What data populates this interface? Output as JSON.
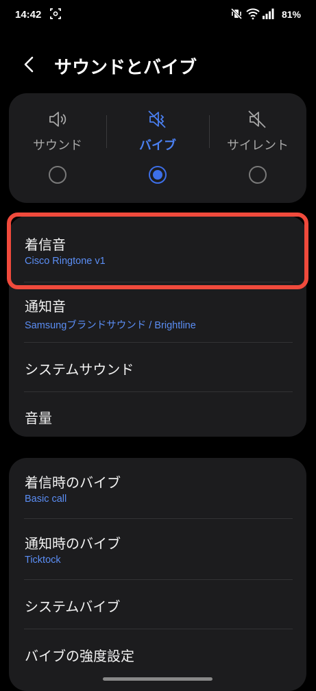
{
  "status_bar": {
    "time": "14:42",
    "battery": "81%"
  },
  "header": {
    "title": "サウンドとバイブ",
    "back_icon": "chevron-left-icon"
  },
  "modes": [
    {
      "label": "サウンド",
      "icon": "speaker-icon",
      "selected": false
    },
    {
      "label": "バイブ",
      "icon": "vibrate-icon",
      "selected": true
    },
    {
      "label": "サイレント",
      "icon": "mute-icon",
      "selected": false
    }
  ],
  "sound_settings": [
    {
      "title": "着信音",
      "subtitle": "Cisco Ringtone v1"
    },
    {
      "title": "通知音",
      "subtitle": "Samsungブランドサウンド / Brightline"
    },
    {
      "title": "システムサウンド"
    },
    {
      "title": "音量"
    }
  ],
  "vibration_settings": [
    {
      "title": "着信時のバイブ",
      "subtitle": "Basic call"
    },
    {
      "title": "通知時のバイブ",
      "subtitle": "Ticktock"
    },
    {
      "title": "システムバイブ"
    },
    {
      "title": "バイブの強度設定"
    }
  ],
  "colors": {
    "accent": "#3d6fe8",
    "subtitle": "#5b8ef5",
    "highlight": "#f04a3c",
    "card": "#1c1c1e"
  }
}
